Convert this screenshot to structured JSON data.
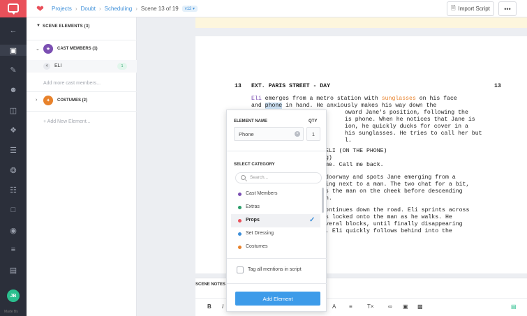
{
  "breadcrumb": {
    "projects": "Projects",
    "project": "Doubt",
    "section": "Scheduling",
    "scene": "Scene 13 of 19",
    "version": "v12"
  },
  "toolbar": {
    "import_label": "Import Script",
    "more_label": "•••"
  },
  "nav": {
    "avatar_initials": "JB",
    "made_by": "Made By"
  },
  "panel": {
    "header": "SCENE ELEMENTS (3)",
    "cast_title": "CAST MEMBERS (1)",
    "cast_items": [
      {
        "number": "4",
        "name": "ELI",
        "count": "1"
      }
    ],
    "add_cast_placeholder": "Add more cast members...",
    "costumes_title": "COSTUMES (2)",
    "add_element": "+ Add New Element..."
  },
  "script": {
    "scene_number": "13",
    "heading": "EXT. PARIS STREET - DAY",
    "action1": {
      "char": "Eli",
      "mid1": " emerges from a metro station with ",
      "prop1": "sunglasses",
      "mid2": " on his face",
      "line2a": "and ",
      "prop2": "phone",
      "line2b": " in hand. He anxiously makes his way down the",
      "line3": "oward Jane's position, following the",
      "line4": "is phone. When he notices that Jane is",
      "line5": "ion, he quickly ducks for cover in a",
      "line6": "his sunglasses. He tries to call her but",
      "line7": "l."
    },
    "dialogue": {
      "line1": "ELI (ON THE PHONE)",
      "line2": "g)",
      "line3": "me. Call me back."
    },
    "action2": {
      "line1": "doorway and spots Jane emerging from a",
      "line2": "ing next to a man. The two chat for a bit,",
      "line3": "s the man on the cheek before descending",
      "line4": "n."
    },
    "action3": {
      "line1": "ontinues down the road. Eli sprints across",
      "line2": "s locked onto the man as he walks. He",
      "line3": "veral blocks, until finally disappearing",
      "line4": ". Eli quickly follows behind into the"
    }
  },
  "notes": {
    "label": "SCENE NOTES"
  },
  "popup": {
    "element_name_label": "ELEMENT NAME",
    "qty_label": "QTY",
    "element_name_value": "Phone",
    "qty_value": "1",
    "select_category_label": "SELECT CATEGORY",
    "search_placeholder": "Search...",
    "categories": [
      {
        "label": "Cast Members",
        "color": "#7b4fb2"
      },
      {
        "label": "Extras",
        "color": "#2a9d6a"
      },
      {
        "label": "Props",
        "color": "#e9505a"
      },
      {
        "label": "Set Dressing",
        "color": "#3d8fd9"
      },
      {
        "label": "Costumes",
        "color": "#e8822b"
      }
    ],
    "selected_category": "Props",
    "tag_all_label": "Tag all mentions in script",
    "add_button": "Add Element"
  },
  "colors": {
    "accent": "#3d8fd9",
    "brand": "#e9505a",
    "nav_bg": "#2b2f3a",
    "button": "#3d9be9"
  }
}
